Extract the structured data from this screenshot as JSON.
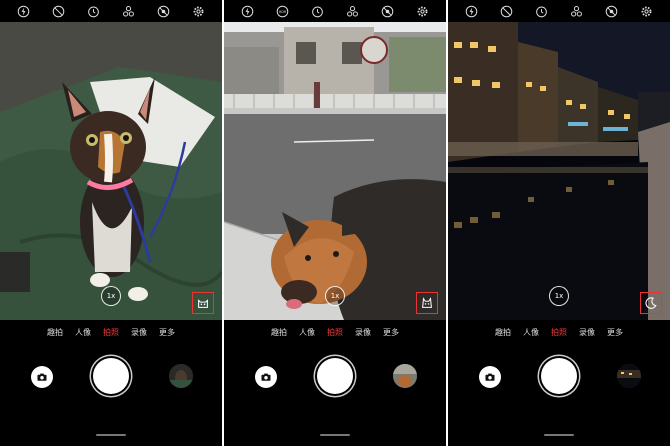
{
  "screens": [
    {
      "scene": "cat",
      "zoom": "1x",
      "scene_badge": "cat-icon",
      "modes": [
        "趣拍",
        "人像",
        "拍照",
        "录像",
        "更多"
      ],
      "active_mode": "拍照"
    },
    {
      "scene": "dog",
      "zoom": "1x",
      "scene_badge": "dog-icon",
      "modes": [
        "趣拍",
        "人像",
        "拍照",
        "录像",
        "更多"
      ],
      "active_mode": "拍照"
    },
    {
      "scene": "night",
      "zoom": "1x",
      "scene_badge": "moon-icon",
      "modes": [
        "趣拍",
        "人像",
        "拍照",
        "录像",
        "更多"
      ],
      "active_mode": "拍照"
    }
  ],
  "topbar_icons": [
    "flash-off-icon",
    "hdr-icon",
    "timer-icon",
    "filter-icon",
    "ai-off-icon",
    "settings-icon"
  ],
  "topbar_hdr_label": "HDR",
  "colors": {
    "active_mode": "#f03c3c",
    "badge_border": "#e33333"
  }
}
